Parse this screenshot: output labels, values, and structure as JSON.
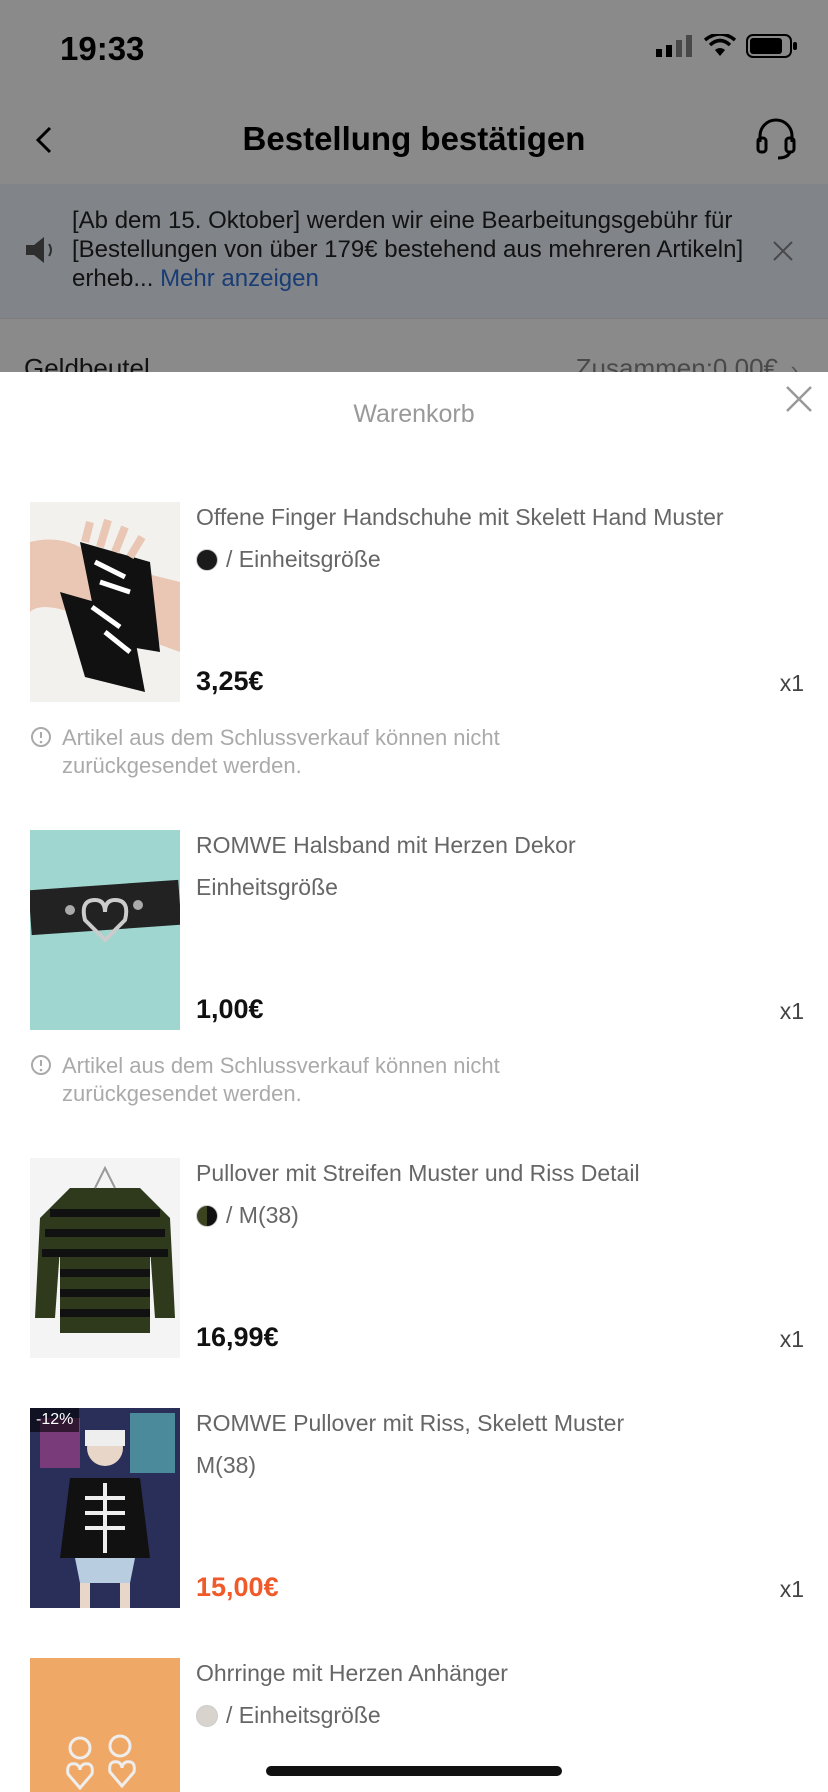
{
  "status": {
    "time": "19:33"
  },
  "nav": {
    "title": "Bestellung bestätigen"
  },
  "notice": {
    "text": "[Ab dem 15. Oktober] werden wir eine Bearbeitungsgebühr für [Bestellungen von über 179€ bestehend aus mehreren Artikeln] erheb...",
    "more": "Mehr anzeigen"
  },
  "wallet": {
    "label": "Geldbeutel",
    "value": "Zusammen:0,00€"
  },
  "sheet": {
    "title": "Warenkorb",
    "items": [
      {
        "name": "Offene Finger Handschuhe mit Skelett Hand Muster",
        "variant": "/ Einheitsgröße",
        "swatch_color": "#1a1a1a",
        "price": "3,25€",
        "qty": "x1",
        "warning": "Artikel aus dem Schlussverkauf können nicht zurückgesendet werden."
      },
      {
        "name": "ROMWE Halsband mit Herzen Dekor",
        "variant": "Einheitsgröße",
        "price": "1,00€",
        "qty": "x1",
        "warning": "Artikel aus dem Schlussverkauf können nicht zurückgesendet werden."
      },
      {
        "name": "Pullover mit Streifen Muster und Riss Detail",
        "variant": "/ M(38)",
        "swatch_color": "#3b4320",
        "price": "16,99€",
        "qty": "x1"
      },
      {
        "name": "ROMWE Pullover mit Riss, Skelett Muster",
        "variant": "M(38)",
        "badge": "-12%",
        "price": "15,00€",
        "price_color": "#f05a2a",
        "qty": "x1"
      },
      {
        "name": "Ohrringe mit Herzen Anhänger",
        "variant": "/ Einheitsgröße",
        "swatch_color": "#d9d3ce"
      }
    ]
  }
}
